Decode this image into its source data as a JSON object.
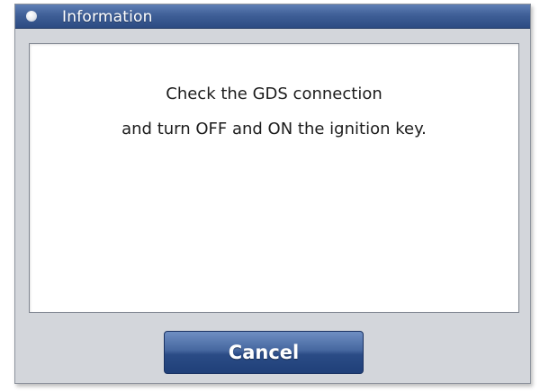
{
  "dialog": {
    "title": "Information",
    "title_icon": "dot-icon",
    "message": {
      "line1": "Check the GDS connection",
      "line2": "and turn OFF and ON the ignition key."
    },
    "cancel_label": "Cancel"
  },
  "colors": {
    "titlebar": "#3f5f97",
    "dialog_background": "#d3d6db",
    "panel_background": "#ffffff",
    "button": "#2b4c86",
    "text": "#1c1c1c"
  }
}
